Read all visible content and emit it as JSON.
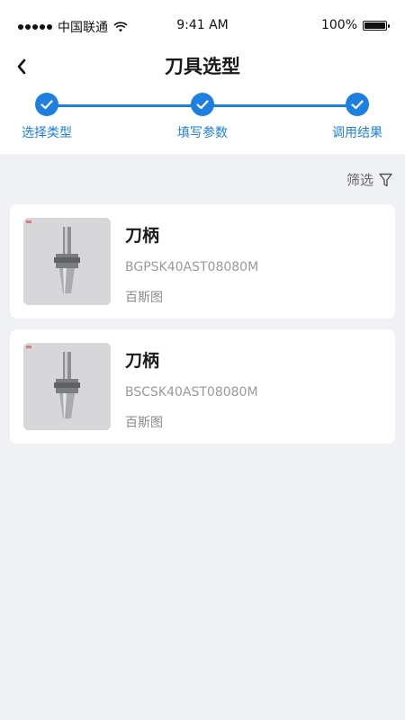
{
  "status_bar": {
    "carrier": "中国联通",
    "time": "9:41 AM",
    "battery": "100%",
    "battery_level": 1.0
  },
  "header": {
    "title": "刀具选型"
  },
  "steps": [
    {
      "label": "选择类型",
      "completed": true
    },
    {
      "label": "填写参数",
      "completed": true
    },
    {
      "label": "调用结果",
      "completed": true
    }
  ],
  "filter": {
    "label": "筛选"
  },
  "products": [
    {
      "name": "刀柄",
      "code": "BGPSK40AST08080M",
      "brand": "百斯图"
    },
    {
      "name": "刀柄",
      "code": "BSCSK40AST08080M",
      "brand": "百斯图"
    }
  ],
  "colors": {
    "accent": "#1d7fe0",
    "background": "#f0f1f5",
    "card": "#ffffff"
  },
  "icons": {
    "back": "chevron-left-icon",
    "step_done": "check-icon",
    "filter": "funnel-icon"
  }
}
